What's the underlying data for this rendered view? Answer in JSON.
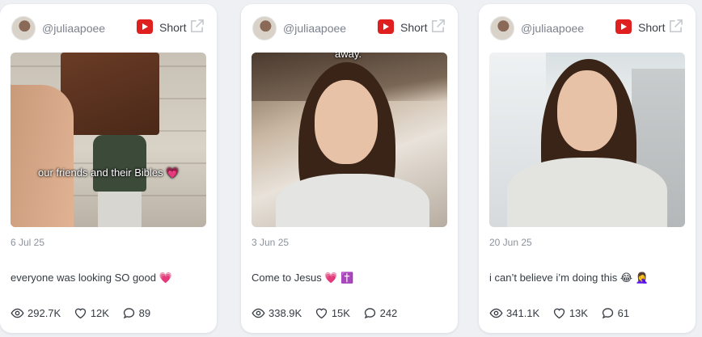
{
  "cards": [
    {
      "handle": "@juliaapoee",
      "type_label": "Short",
      "overlay_text": "away.",
      "date": "3 Jun 25",
      "caption": "Come to Jesus 💗 ✝️",
      "views": "338.9K",
      "likes": "15K",
      "comments": "242"
    },
    {
      "handle": "@juliaapoee",
      "type_label": "Short",
      "overlay_text": "",
      "date": "20 Jun 25",
      "caption": "i can’t believe i’m doing this 😂 🤦‍♀️",
      "views": "341.1K",
      "likes": "13K",
      "comments": "61"
    },
    {
      "handle": "@juliaapoee",
      "type_label": "Short",
      "overlay_text": "our friends and their Bibles 💗",
      "date": "6 Jul 25",
      "caption": "everyone was looking SO good 💗",
      "views": "292.7K",
      "likes": "12K",
      "comments": "89"
    }
  ],
  "icons": {
    "platform": "youtube-icon",
    "external": "external-link-icon",
    "views": "eye-icon",
    "likes": "heart-icon",
    "comments": "comment-icon"
  },
  "colors": {
    "youtube_red": "#e01f1f",
    "muted_text": "#8c929c",
    "background": "#eef0f4"
  }
}
